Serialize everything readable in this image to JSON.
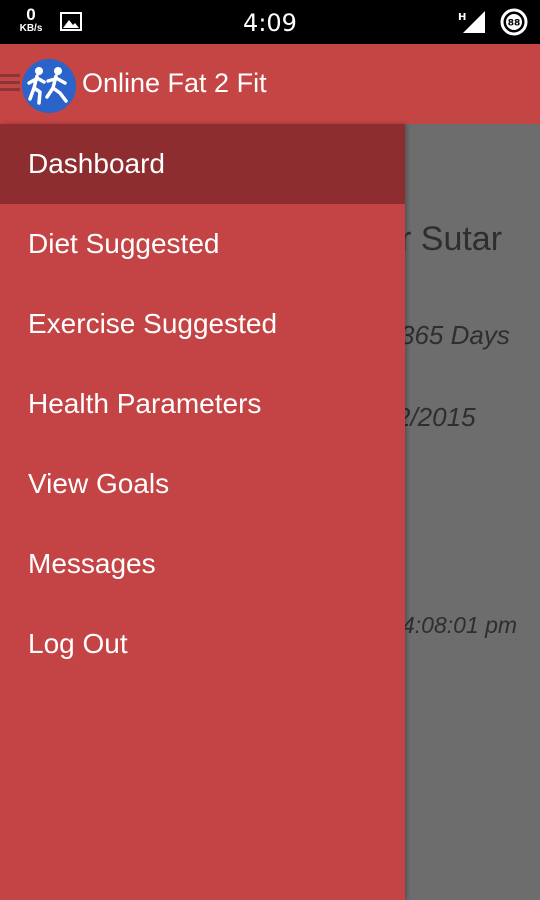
{
  "status_bar": {
    "net_speed_value": "0",
    "net_speed_unit": "KB/s",
    "time": "4:09",
    "network_type": "H",
    "battery_level": "88"
  },
  "app_bar": {
    "title": "Online Fat 2 Fit"
  },
  "drawer": {
    "items": [
      {
        "label": "Dashboard",
        "active": true
      },
      {
        "label": "Diet Suggested"
      },
      {
        "label": "Exercise Suggested"
      },
      {
        "label": "Health Parameters"
      },
      {
        "label": "View Goals"
      },
      {
        "label": "Messages"
      },
      {
        "label": "Log Out"
      }
    ]
  },
  "background": {
    "name_fragment": "r Sutar",
    "days_fragment": "365 Days",
    "date_fragment": "2/2015",
    "time_fragment": "4:08:01 pm"
  },
  "colors": {
    "app_bar": "#c54444",
    "drawer": "#c44344",
    "active_item": "#8e2d2f",
    "logo_circle": "#2a63c9",
    "scrim": "#6d6d6d"
  }
}
